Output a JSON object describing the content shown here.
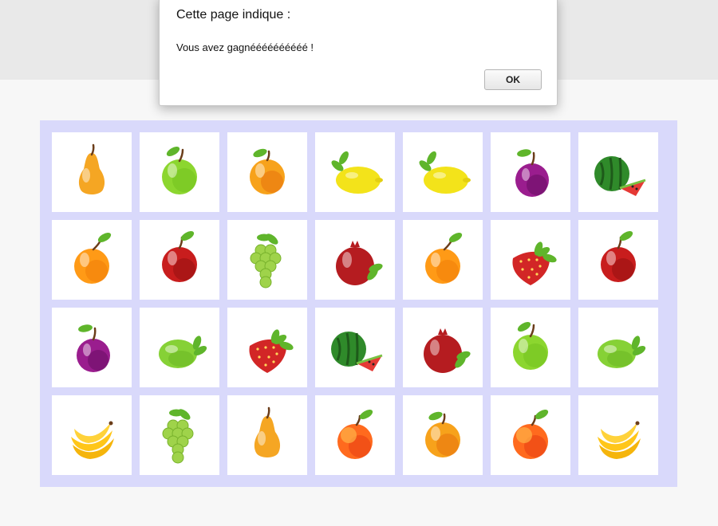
{
  "dialog": {
    "title": "Cette page indique :",
    "message": "Vous avez gagnéééééééééé !",
    "ok_label": "OK"
  },
  "board": {
    "columns": 7,
    "rows": 4,
    "cards": [
      "pear",
      "green-apple",
      "apricot",
      "lemon",
      "lemon",
      "plum",
      "watermelon",
      "orange",
      "red-apple",
      "grapes",
      "pomegranate",
      "orange",
      "strawberry",
      "red-apple",
      "plum",
      "lime",
      "strawberry",
      "watermelon",
      "pomegranate",
      "green-apple",
      "lime",
      "banana",
      "grapes",
      "pear",
      "peach",
      "apricot",
      "peach",
      "banana"
    ]
  }
}
